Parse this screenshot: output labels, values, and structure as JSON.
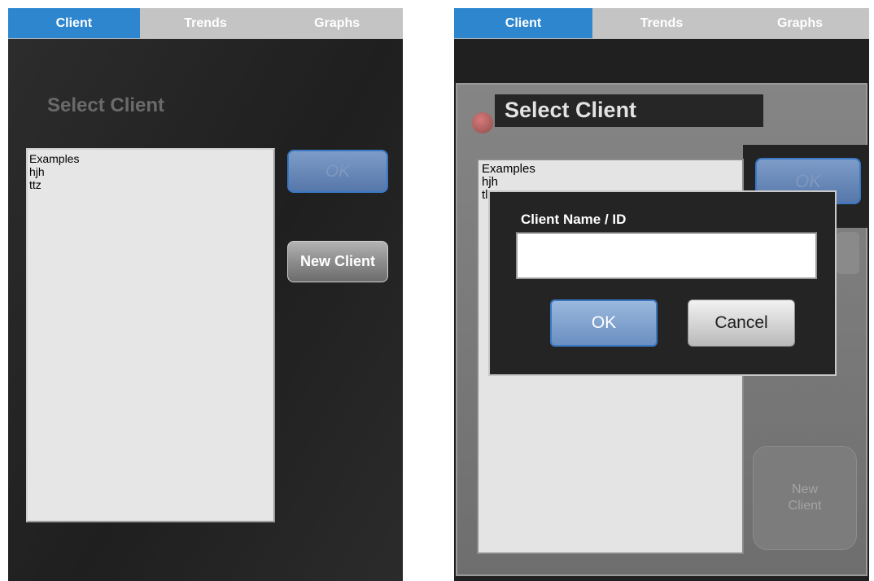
{
  "tabs": [
    "Client",
    "Trends",
    "Graphs"
  ],
  "left": {
    "title": "Select Client",
    "clients": [
      "Examples",
      "hjh",
      "ttz"
    ],
    "ok_label": "OK",
    "new_client_label": "New Client"
  },
  "right": {
    "title": "Select Client",
    "clients": [
      "Examples",
      "hjh",
      "tl"
    ],
    "ok_label": "OK",
    "new_client_label_line1": "New",
    "new_client_label_line2": "Client",
    "dialog": {
      "label": "Client Name / ID",
      "input_value": "",
      "ok_label": "OK",
      "cancel_label": "Cancel"
    }
  },
  "colors": {
    "tab_active": "#2e86cf",
    "tab_inactive": "#c4c4c4",
    "ok_button": "#5677aa"
  }
}
